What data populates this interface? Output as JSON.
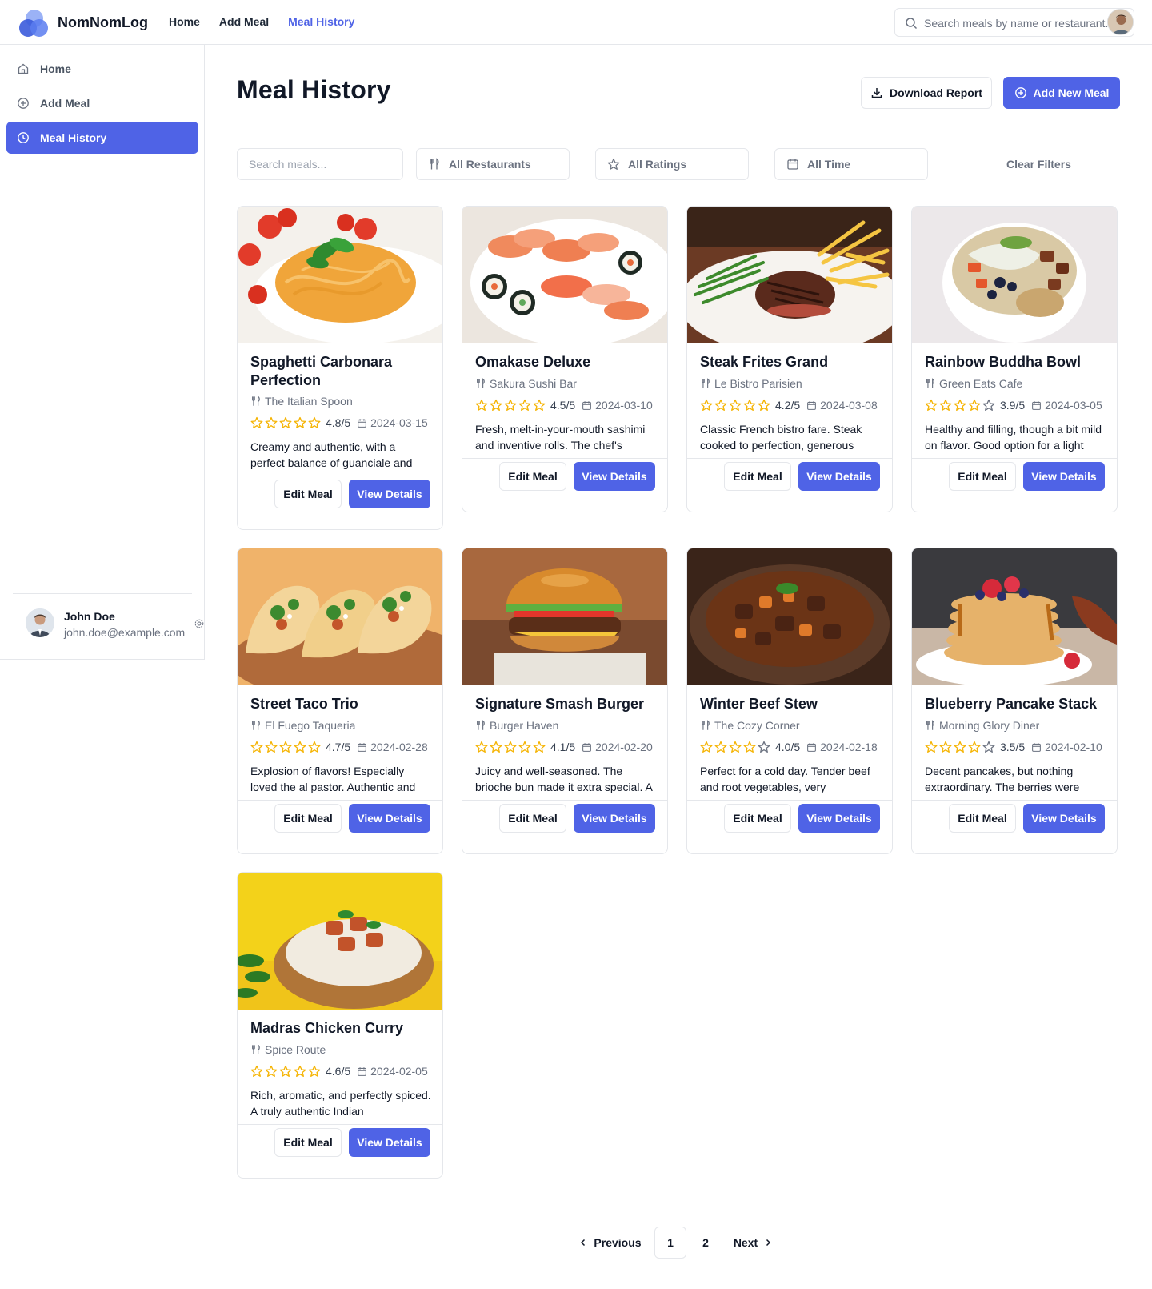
{
  "app": {
    "brand": "NomNomLog",
    "nav": [
      "Home",
      "Add Meal",
      "Meal History"
    ],
    "active_nav": "Meal History",
    "search_placeholder": "Search meals by name or restaurant..."
  },
  "sidebar": {
    "items": [
      {
        "label": "Home",
        "icon": "home-icon"
      },
      {
        "label": "Add Meal",
        "icon": "plus-circle-icon"
      },
      {
        "label": "Meal History",
        "icon": "clock-icon",
        "active": true
      }
    ],
    "user": {
      "name": "John Doe",
      "email": "john.doe@example.com"
    }
  },
  "main": {
    "title": "Meal History",
    "download_label": "Download Report",
    "add_label": "Add New Meal",
    "filters": {
      "search_placeholder": "Search meals...",
      "restaurants": "All Restaurants",
      "ratings": "All Ratings",
      "time": "All Time",
      "clear": "Clear Filters"
    },
    "card_actions": {
      "edit": "Edit Meal",
      "view": "View Details"
    },
    "meals": [
      {
        "title": "Spaghetti Carbonara Perfection",
        "restaurant": "The Italian Spoon",
        "rating": "4.8/5",
        "stars": 5,
        "date": "2024-03-15",
        "desc": "Creamy and authentic, with a perfect balance of guanciale and",
        "image": "pasta"
      },
      {
        "title": "Omakase Deluxe",
        "restaurant": "Sakura Sushi Bar",
        "rating": "4.5/5",
        "stars": 5,
        "date": "2024-03-10",
        "desc": "Fresh, melt-in-your-mouth sashimi and inventive rolls. The chef's",
        "image": "sushi"
      },
      {
        "title": "Steak Frites Grand",
        "restaurant": "Le Bistro Parisien",
        "rating": "4.2/5",
        "stars": 5,
        "date": "2024-03-08",
        "desc": "Classic French bistro fare. Steak cooked to perfection, generous",
        "image": "steak"
      },
      {
        "title": "Rainbow Buddha Bowl",
        "restaurant": "Green Eats Cafe",
        "rating": "3.9/5",
        "stars": 4,
        "date": "2024-03-05",
        "desc": "Healthy and filling, though a bit mild on flavor. Good option for a light",
        "image": "bowl"
      },
      {
        "title": "Street Taco Trio",
        "restaurant": "El Fuego Taqueria",
        "rating": "4.7/5",
        "stars": 5,
        "date": "2024-02-28",
        "desc": "Explosion of flavors! Especially loved the al pastor. Authentic and",
        "image": "tacos"
      },
      {
        "title": "Signature Smash Burger",
        "restaurant": "Burger Haven",
        "rating": "4.1/5",
        "stars": 5,
        "date": "2024-02-20",
        "desc": "Juicy and well-seasoned. The brioche bun made it extra special. A",
        "image": "burger"
      },
      {
        "title": "Winter Beef Stew",
        "restaurant": "The Cozy Corner",
        "rating": "4.0/5",
        "stars": 4,
        "date": "2024-02-18",
        "desc": "Perfect for a cold day. Tender beef and root vegetables, very",
        "image": "stew"
      },
      {
        "title": "Blueberry Pancake Stack",
        "restaurant": "Morning Glory Diner",
        "rating": "3.5/5",
        "stars": 4,
        "date": "2024-02-10",
        "desc": "Decent pancakes, but nothing extraordinary. The berries were",
        "image": "pancakes"
      },
      {
        "title": "Madras Chicken Curry",
        "restaurant": "Spice Route",
        "rating": "4.6/5",
        "stars": 5,
        "date": "2024-02-05",
        "desc": "Rich, aromatic, and perfectly spiced. A truly authentic Indian",
        "image": "curry"
      }
    ],
    "pagination": {
      "previous": "Previous",
      "pages": [
        "1",
        "2"
      ],
      "current": "1",
      "next": "Next"
    }
  },
  "colors": {
    "accent": "#4f63e6",
    "star": "#f5b301",
    "border": "#e5e7eb"
  }
}
